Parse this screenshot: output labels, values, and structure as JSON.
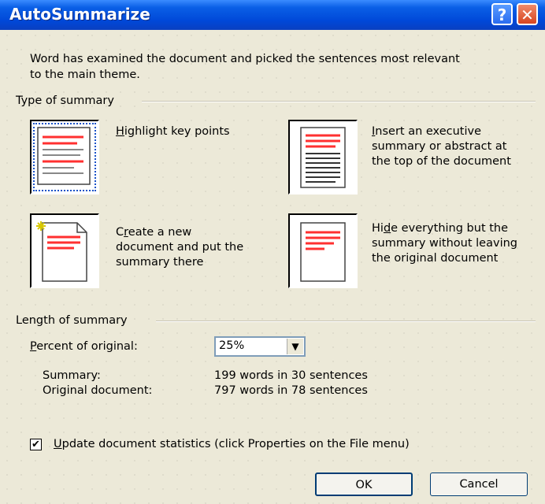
{
  "window": {
    "title": "AutoSummarize",
    "help_icon": "question-mark-icon",
    "close_icon": "close-x-icon"
  },
  "intro": {
    "line1": "Word has examined the document and picked the sentences most relevant",
    "line2": "to the main theme."
  },
  "type_group": {
    "label": "Type of summary",
    "options": [
      {
        "key": "H",
        "rest": "ighlight key points",
        "lines": []
      },
      {
        "key": "I",
        "rest": "nsert an executive",
        "lines": [
          "summary or abstract at",
          "the top of the document"
        ]
      },
      {
        "pre": "C",
        "key": "r",
        "rest": "eate a new",
        "lines": [
          "document and put the",
          "summary there"
        ]
      },
      {
        "pre": "Hi",
        "key": "d",
        "rest": "e everything but the",
        "lines": [
          "summary without leaving",
          "the original document"
        ]
      }
    ],
    "selected_index": 0
  },
  "length_group": {
    "label": "Length of summary",
    "percent_label_key": "P",
    "percent_label_rest": "ercent of original:",
    "percent_value": "25%",
    "summary_label": "Summary:",
    "summary_value": "199 words in 30 sentences",
    "original_label": "Original document:",
    "original_value": "797 words in 78 sentences"
  },
  "update_stats": {
    "checked": true,
    "check_mark": "✔",
    "key": "U",
    "rest": "pdate document statistics (click Properties on the File menu)"
  },
  "buttons": {
    "ok": "OK",
    "cancel": "Cancel"
  },
  "colors": {
    "accent_red": "#ff3030",
    "title_blue": "#0048d8"
  }
}
